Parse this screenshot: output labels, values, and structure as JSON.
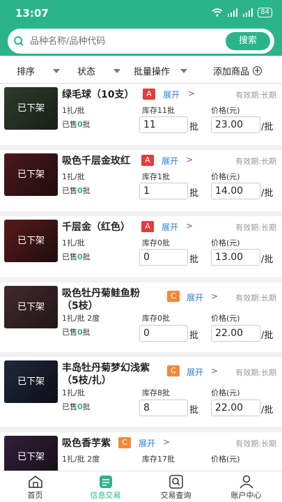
{
  "status": {
    "time": "13:07",
    "battery": "84"
  },
  "search": {
    "placeholder": "品种名称/品种代码",
    "button": "搜索"
  },
  "filters": {
    "sort": "排序",
    "status": "状态",
    "batch": "批量操作",
    "add": "添加商品"
  },
  "labels": {
    "expand": "展开",
    "valid": "有效期:长期",
    "stock_prefix": "库存",
    "price": "价格(元)",
    "sold_prefix": "已售",
    "sold_suffix": "批",
    "unit": "批",
    "unit_per": "/批",
    "offline": "已下架"
  },
  "products": [
    {
      "name": "绿毛球（10支）",
      "grade": "A",
      "spec": "1扎/批",
      "stock": "库存11批",
      "sold": "0",
      "qty": "11",
      "price": "23.00"
    },
    {
      "name": "吸色千层金玫红",
      "grade": "A",
      "spec": "1扎/批",
      "stock": "库存1批",
      "sold": "0",
      "qty": "1",
      "price": "14.00"
    },
    {
      "name": "千层金（红色）",
      "grade": "A",
      "spec": "1扎/批",
      "stock": "库存0批",
      "sold": "0",
      "qty": "0",
      "price": "13.00"
    },
    {
      "name_line1": "吸色牡丹菊鲑鱼粉",
      "name_line2": "（5枝）",
      "grade": "C",
      "spec": "1扎/批 2度",
      "stock": "库存0批",
      "sold": "0",
      "qty": "0",
      "price": "22.00"
    },
    {
      "name_line1": "丰岛牡丹菊梦幻浅紫",
      "name_line2": "（5枝/扎）",
      "grade": "C",
      "spec": "1扎/批",
      "stock": "库存8批",
      "sold": "0",
      "qty": "8",
      "price": "22.00"
    },
    {
      "name": "吸色香芋紫",
      "grade": "C",
      "spec": "1扎/批 2度",
      "stock": "库存17批",
      "price_label_only": true
    }
  ],
  "tabs": [
    {
      "label": "首页",
      "icon": "home-icon"
    },
    {
      "label": "信息交易",
      "icon": "document-icon",
      "active": true
    },
    {
      "label": "交易查询",
      "icon": "search-doc-icon"
    },
    {
      "label": "账户中心",
      "icon": "user-icon"
    }
  ],
  "colors": {
    "primary": "#2bb48a",
    "grade_a": "#e53b3b",
    "grade_c": "#f08a3a",
    "link": "#2f7fd8"
  }
}
